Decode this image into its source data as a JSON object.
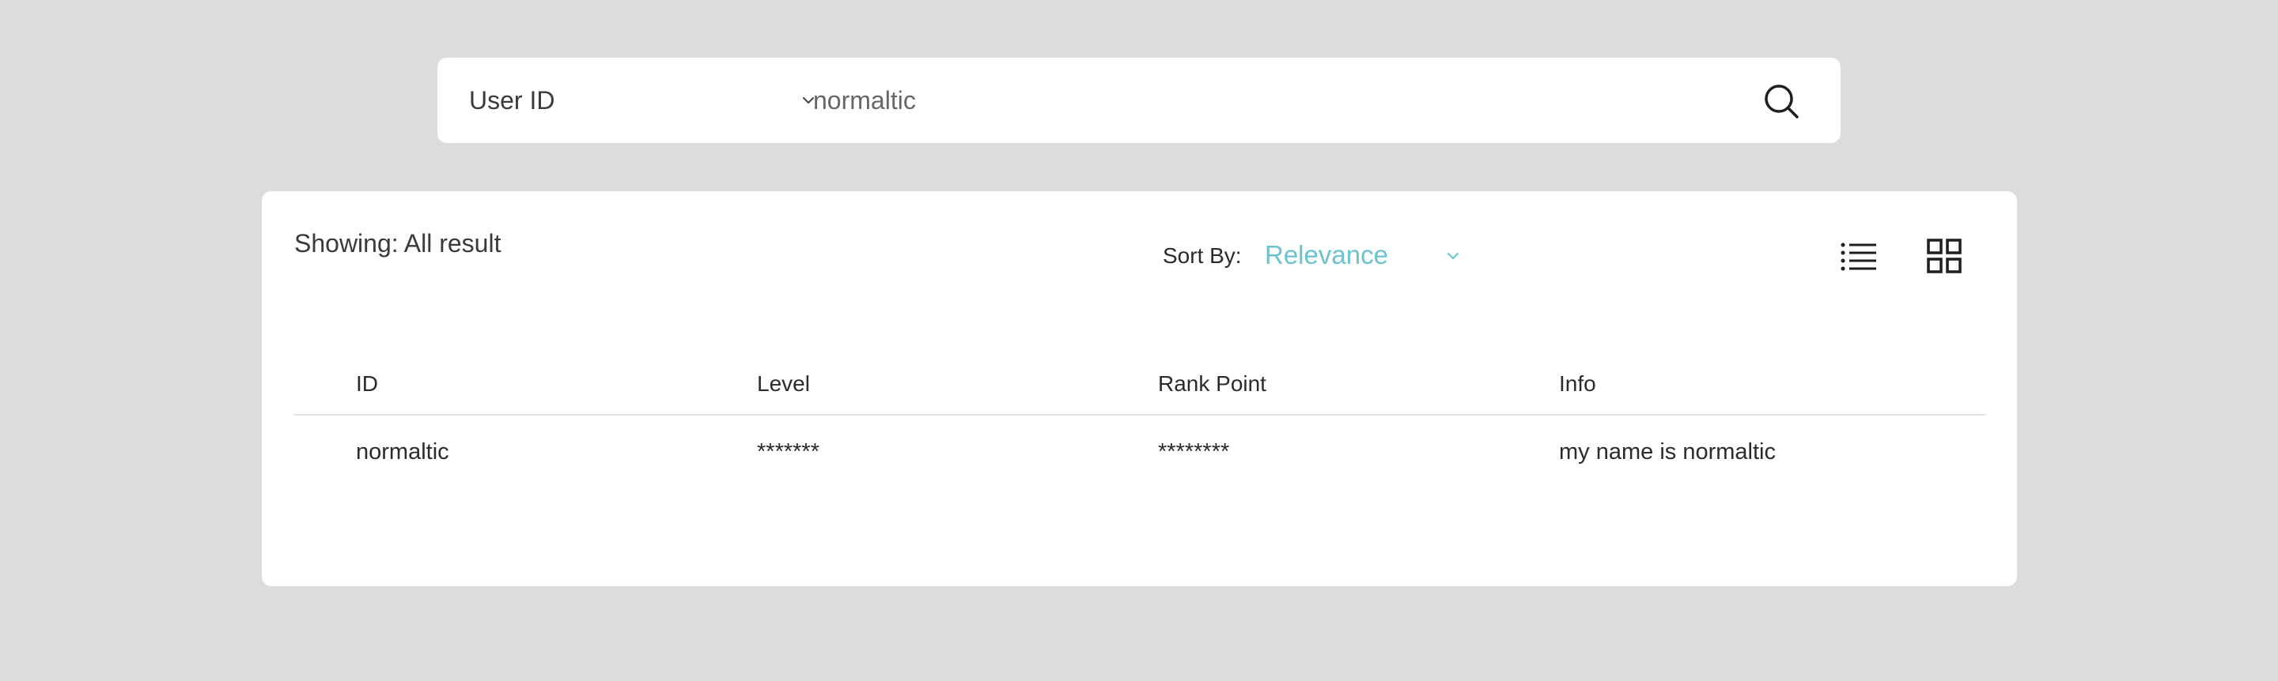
{
  "search": {
    "type_label": "User ID",
    "value": "normaltic"
  },
  "results": {
    "showing_text": "Showing: All result",
    "sort_label": "Sort By:",
    "sort_value": "Relevance",
    "columns": [
      "ID",
      "Level",
      "Rank Point",
      "Info"
    ],
    "rows": [
      [
        "normaltic",
        "*******",
        "********",
        "my name is normaltic"
      ]
    ]
  },
  "colors": {
    "background": "#dcdcdc",
    "panel": "#ffffff",
    "accent": "#6cc3cf"
  }
}
